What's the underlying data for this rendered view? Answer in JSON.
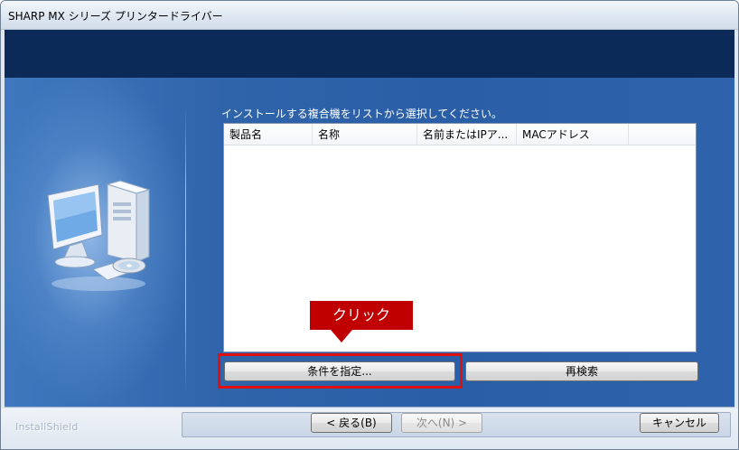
{
  "window": {
    "title": "SHARP MX シリーズ プリンタードライバー"
  },
  "main": {
    "instruction": "インストールする複合機をリストから選択してください。",
    "list": {
      "columns": [
        "製品名",
        "名称",
        "名前またはIPア...",
        "MACアドレス",
        ""
      ],
      "rows": []
    },
    "conditions_button": "条件を指定...",
    "research_button": "再検索"
  },
  "annotation": {
    "callout_text": "クリック",
    "color": "#c00000",
    "highlight_color": "#e01010"
  },
  "footer": {
    "brand": "InstallShield",
    "back_button": "< 戻る(B)",
    "next_button": "次へ(N) >",
    "cancel_button": "キャンセル"
  },
  "colors": {
    "banner": "#0c2a58",
    "panel": "#2f64ab"
  },
  "icons": [
    "computer-setup-icon"
  ]
}
